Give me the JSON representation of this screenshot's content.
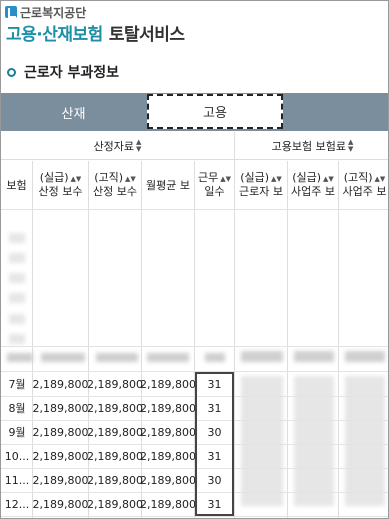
{
  "header": {
    "org_name": "근로복지공단",
    "title_main": "고용·산재보험",
    "title_sub": "토탈서비스"
  },
  "section": {
    "title": "근로자 부과정보"
  },
  "tabs": [
    {
      "label": "산재",
      "selected": false
    },
    {
      "label": "고용",
      "selected": true
    }
  ],
  "table": {
    "group_headers": [
      "산정자료",
      "고용보험 보험료"
    ],
    "columns": [
      "보험",
      "(실급)\n산정 보수",
      "(고직)\n산정 보수",
      "월평균 보",
      "근무\n일수",
      "(실급)\n근로자 보",
      "(실급)\n사업주 보",
      "(고직)\n사업주 보"
    ],
    "rows": [
      {
        "month": "7월",
        "a": "2,189,800",
        "b": "2,189,800",
        "c": "2,189,800",
        "days": "31"
      },
      {
        "month": "8월",
        "a": "2,189,800",
        "b": "2,189,800",
        "c": "2,189,800",
        "days": "31"
      },
      {
        "month": "9월",
        "a": "2,189,800",
        "b": "2,189,800",
        "c": "2,189,800",
        "days": "30"
      },
      {
        "month": "10...",
        "a": "2,189,800",
        "b": "2,189,800",
        "c": "2,189,800",
        "days": "31"
      },
      {
        "month": "11...",
        "a": "2,189,800",
        "b": "2,189,800",
        "c": "2,189,800",
        "days": "30"
      },
      {
        "month": "12...",
        "a": "2,189,800",
        "b": "2,189,800",
        "c": "2,189,800",
        "days": "31"
      }
    ]
  },
  "colors": {
    "accent": "#1d8fa6",
    "tab_bar": "#7b8e9d"
  }
}
